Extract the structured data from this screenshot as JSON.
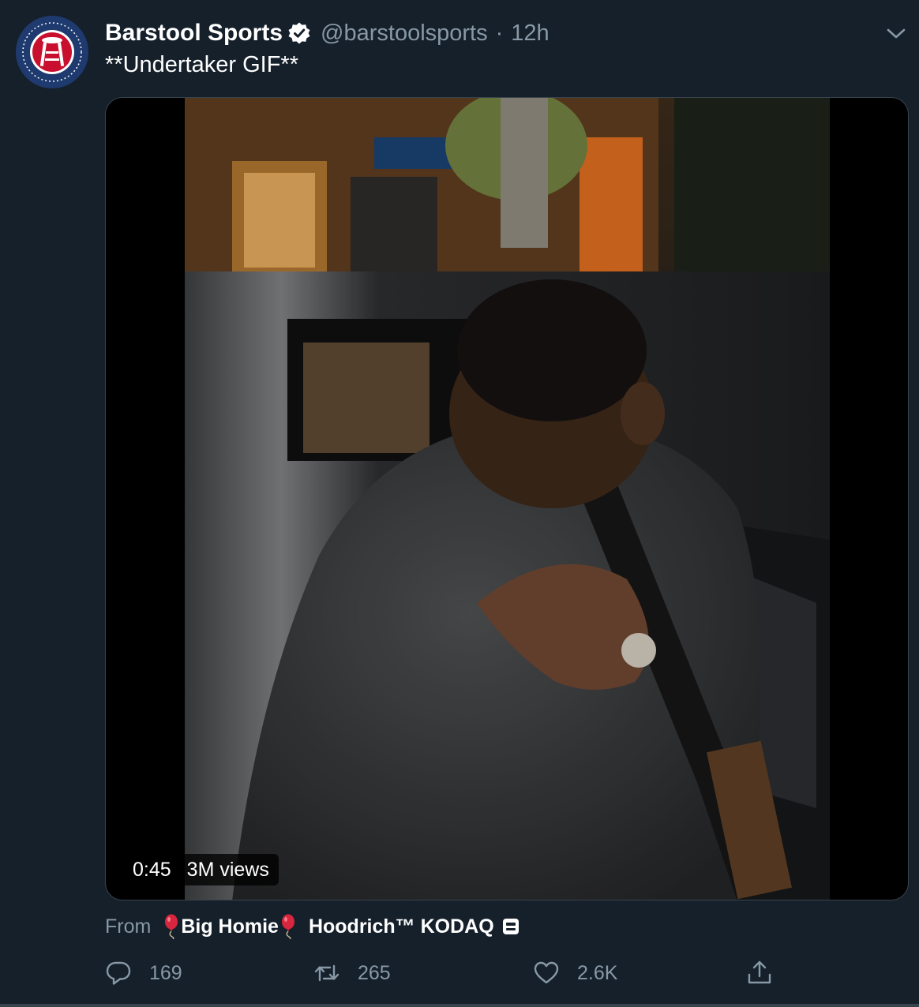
{
  "account": {
    "display_name": "Barstool Sports",
    "handle": "@barstoolsports",
    "separator": "·",
    "time_ago": "12h",
    "verified": true,
    "avatar_icon": "barstool-logo-icon"
  },
  "tweet": {
    "text": "**Undertaker GIF**"
  },
  "media": {
    "type": "video",
    "duration": "0:45",
    "views": "3M views"
  },
  "attribution": {
    "from_label": "From",
    "name_part1": "Big Homie",
    "name_part2": "Hoodrich™ KODAQ",
    "emoji_icon": "balloon-icon"
  },
  "actions": {
    "reply_count": "169",
    "retweet_count": "265",
    "like_count": "2.6K"
  },
  "colors": {
    "background": "#15202b",
    "secondary_text": "#8899a6",
    "border": "#38444d",
    "brand_red": "#c8102e",
    "brand_navy": "#1e3a6e"
  }
}
